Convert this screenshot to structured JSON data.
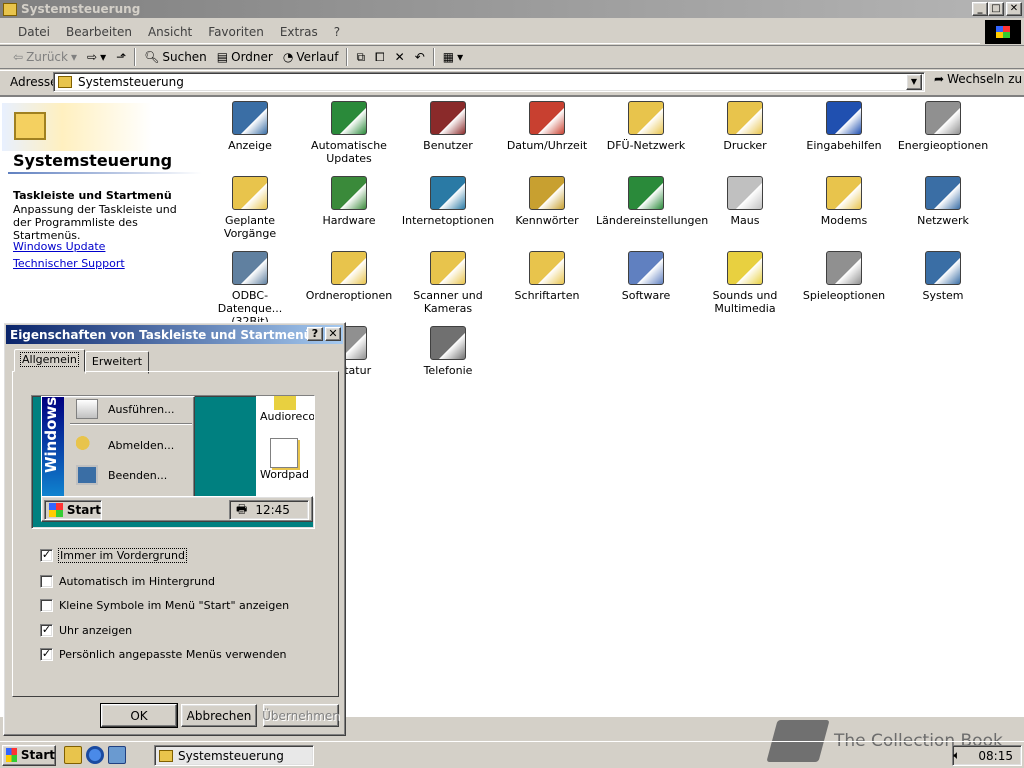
{
  "window": {
    "title": "Systemsteuerung",
    "caption_min": "_",
    "caption_max": "□",
    "caption_close": "✕"
  },
  "menu": [
    "Datei",
    "Bearbeiten",
    "Ansicht",
    "Favoriten",
    "Extras",
    "?"
  ],
  "toolbar": {
    "back": "Zurück",
    "search": "Suchen",
    "folders": "Ordner",
    "history": "Verlauf"
  },
  "address": {
    "label": "Adresse",
    "value": "Systemsteuerung",
    "go": "Wechseln zu"
  },
  "panel": {
    "title": "Systemsteuerung",
    "desc_title": "Taskleiste und Startmenü",
    "desc_text": "Anpassung der Taskleiste und der Programmliste des Startmenüs.",
    "links": [
      "Windows Update",
      "Technischer Support"
    ]
  },
  "icons": [
    {
      "label": "Anzeige",
      "icon": "display-icon",
      "color": "#3a6ea5"
    },
    {
      "label": "Automatische Updates",
      "icon": "globe-update-icon",
      "color": "#2a8a3a"
    },
    {
      "label": "Benutzer",
      "icon": "users-icon",
      "color": "#8a2a2a"
    },
    {
      "label": "Datum/Uhrzeit",
      "icon": "calendar-clock-icon",
      "color": "#c84030"
    },
    {
      "label": "DFÜ-Netzwerk",
      "icon": "folder-network-icon",
      "color": "#e8c44c"
    },
    {
      "label": "Drucker",
      "icon": "folder-printer-icon",
      "color": "#e8c44c"
    },
    {
      "label": "Eingabehilfen",
      "icon": "accessibility-icon",
      "color": "#2050b0"
    },
    {
      "label": "Energieoptionen",
      "icon": "power-icon",
      "color": "#909090"
    },
    {
      "label": "Geplante Vorgänge",
      "icon": "folder-tasks-icon",
      "color": "#e8c44c"
    },
    {
      "label": "Hardware",
      "icon": "hardware-icon",
      "color": "#3a8a3a"
    },
    {
      "label": "Internetoptionen",
      "icon": "internet-icon",
      "color": "#2a7aa5"
    },
    {
      "label": "Kennwörter",
      "icon": "keys-icon",
      "color": "#c8a030"
    },
    {
      "label": "Ländereinstellungen",
      "icon": "globe-icon",
      "color": "#2a8a3a"
    },
    {
      "label": "Maus",
      "icon": "mouse-icon",
      "color": "#c0c0c0"
    },
    {
      "label": "Modems",
      "icon": "modem-icon",
      "color": "#e8c44c"
    },
    {
      "label": "Netzwerk",
      "icon": "network-icon",
      "color": "#3a6ea5"
    },
    {
      "label": "ODBC-Datenque... (32Bit)",
      "icon": "odbc-icon",
      "color": "#6080a0"
    },
    {
      "label": "Ordneroptionen",
      "icon": "folder-options-icon",
      "color": "#e8c44c"
    },
    {
      "label": "Scanner und Kameras",
      "icon": "scanner-icon",
      "color": "#e8c44c"
    },
    {
      "label": "Schriftarten",
      "icon": "fonts-icon",
      "color": "#e8c44c"
    },
    {
      "label": "Software",
      "icon": "software-icon",
      "color": "#6080c0"
    },
    {
      "label": "Sounds und Multimedia",
      "icon": "speaker-icon",
      "color": "#e8d040"
    },
    {
      "label": "Spieleoptionen",
      "icon": "joystick-icon",
      "color": "#909090"
    },
    {
      "label": "System",
      "icon": "computer-icon",
      "color": "#3a6ea5"
    },
    {
      "label": "Tastatur",
      "icon": "keyboard-icon",
      "color": "#909090"
    },
    {
      "label": "Telefonie",
      "icon": "telephony-icon",
      "color": "#707070"
    }
  ],
  "dialog": {
    "title": "Eigenschaften von Taskleiste und Startmenü",
    "help": "?",
    "close": "✕",
    "tabs": [
      "Allgemein",
      "Erweitert"
    ],
    "preview": {
      "band": "Windows",
      "menu_items": [
        "Ausführen...",
        "Abmelden...",
        "Beenden..."
      ],
      "desktop_items": [
        "Audioreco",
        "Wordpad"
      ],
      "start": "Start",
      "clock": "12:45"
    },
    "options": [
      {
        "label": "Immer im Vordergrund",
        "checked": true
      },
      {
        "label": "Automatisch im Hintergrund",
        "checked": false
      },
      {
        "label": "Kleine Symbole im Menü \"Start\" anzeigen",
        "checked": false
      },
      {
        "label": "Uhr anzeigen",
        "checked": true
      },
      {
        "label": "Persönlich angepasste Menüs verwenden",
        "checked": true
      }
    ],
    "buttons": {
      "ok": "OK",
      "cancel": "Abbrechen",
      "apply": "Übernehmen"
    }
  },
  "taskbar": {
    "start": "Start",
    "task": "Systemsteuerung",
    "clock": "08:15"
  },
  "watermark": "The Collection Book"
}
